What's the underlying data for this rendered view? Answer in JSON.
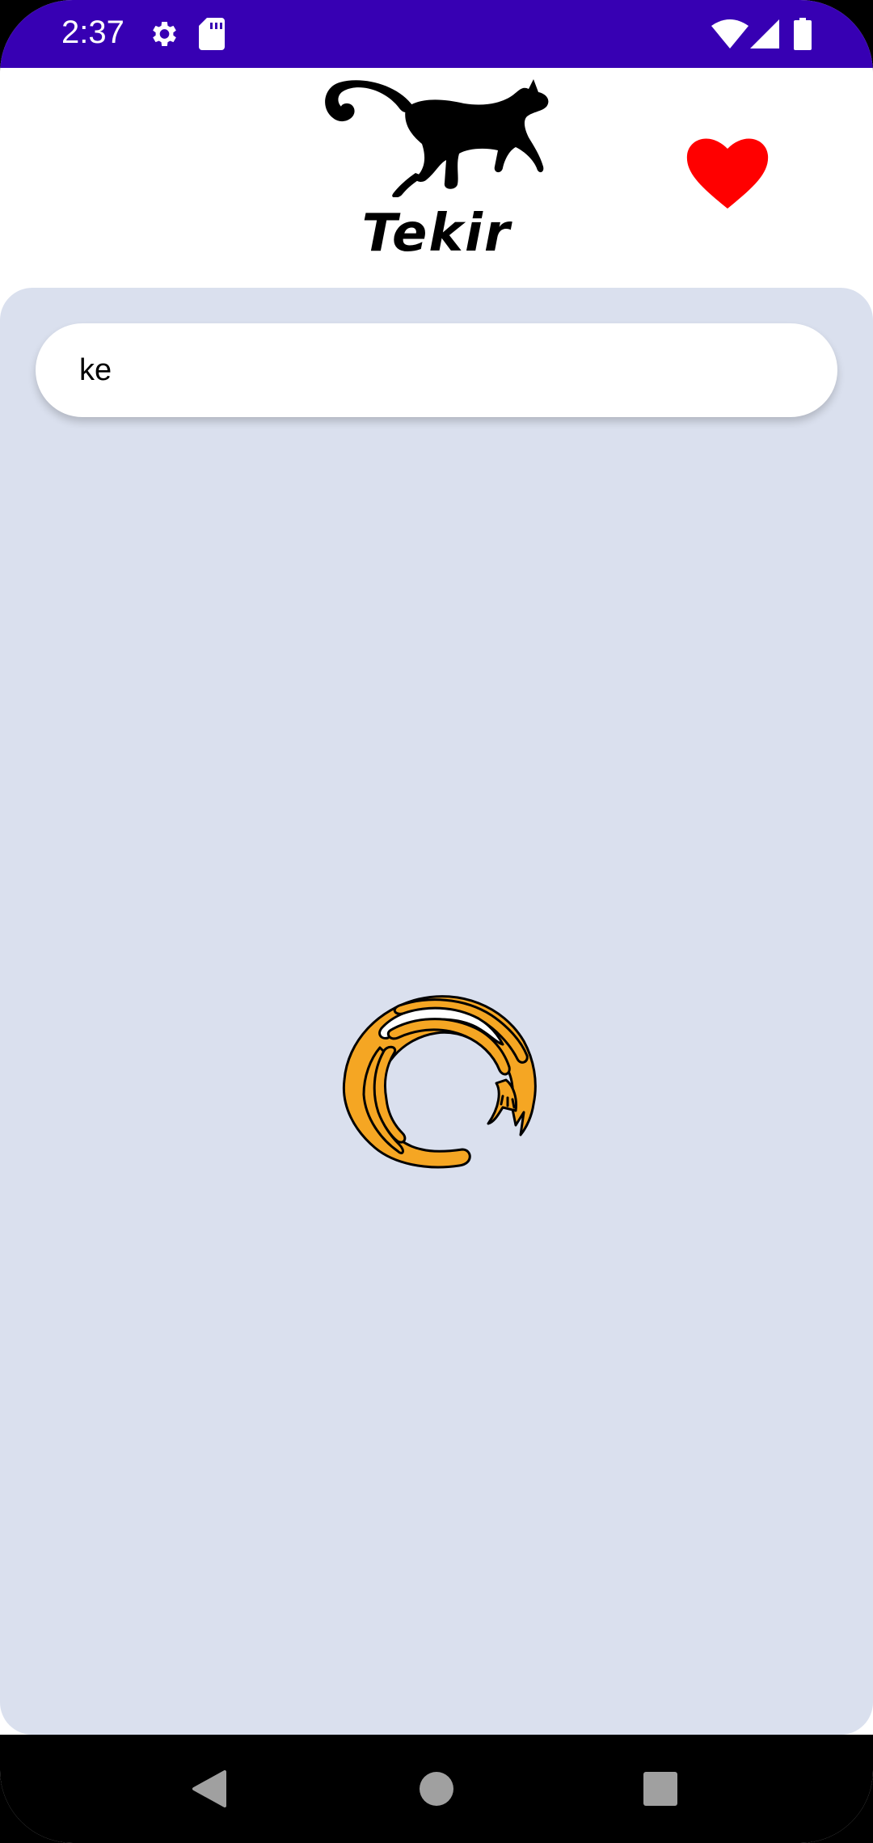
{
  "status_bar": {
    "time": "2:37",
    "icons_left": [
      "gear-icon",
      "sd-card-icon"
    ],
    "icons_right": [
      "wifi-icon",
      "cellular-signal-icon",
      "battery-icon"
    ],
    "background_color": "#3700b3"
  },
  "header": {
    "logo_icon": "walking-cat-icon",
    "app_name": "Tekir",
    "favorites_icon": "heart-icon",
    "favorites_color": "#ff0000"
  },
  "search": {
    "value": "ke"
  },
  "content": {
    "background_color": "#dae0ee",
    "loading_icon": "curled-cat-loading-icon",
    "loading_color": "#f5a623"
  },
  "nav_bar": {
    "buttons": [
      "back-icon",
      "home-icon",
      "recents-icon"
    ]
  }
}
